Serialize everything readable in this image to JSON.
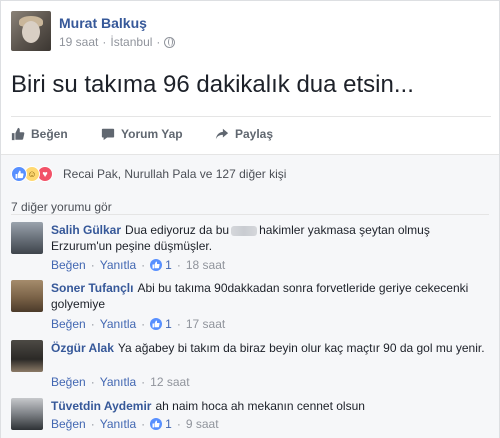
{
  "post": {
    "author": "Murat Balkuş",
    "time": "19 saat",
    "location": "İstanbul",
    "text": "Biri su takıma 96 dakikalık dua etsin..."
  },
  "actions": {
    "like": "Beğen",
    "comment": "Yorum Yap",
    "share": "Paylaş"
  },
  "reactions": {
    "summary": "Recai Pak, Nurullah Pala ve 127 diğer kişi",
    "icons": [
      "like-icon",
      "haha-icon",
      "love-icon"
    ]
  },
  "comments_section": {
    "view_more": "7 diğer yorumu gör",
    "like_label": "Beğen",
    "reply_label": "Yanıtla",
    "items": [
      {
        "author": "Salih Gülkar",
        "text_before": "Dua ediyoruz da bu",
        "text_after": "hakimler yakmasa şeytan olmuş Erzurum'un peşine düşmüşler.",
        "likes": "1",
        "time": "18 saat"
      },
      {
        "author": "Soner Tufançlı",
        "text": "Abi bu takıma 90dakkadan sonra forvetleride geriye cekecenki golyemiye",
        "likes": "1",
        "time": "17 saat"
      },
      {
        "author": "Özgür Alak",
        "text": "Ya ağabey bi takım da biraz beyin olur kaç maçtır 90 da gol mu yenir.",
        "likes": "",
        "time": "12 saat"
      },
      {
        "author": "Tüvetdin Aydemir",
        "text": "ah naim hoca ah mekanın cennet olsun",
        "likes": "1",
        "time": "9 saat"
      }
    ]
  },
  "colors": {
    "link": "#365899",
    "accent": "#4267b2",
    "muted": "#90949c",
    "background_gray": "#f6f7f9",
    "like_blue": "#5890ff"
  }
}
